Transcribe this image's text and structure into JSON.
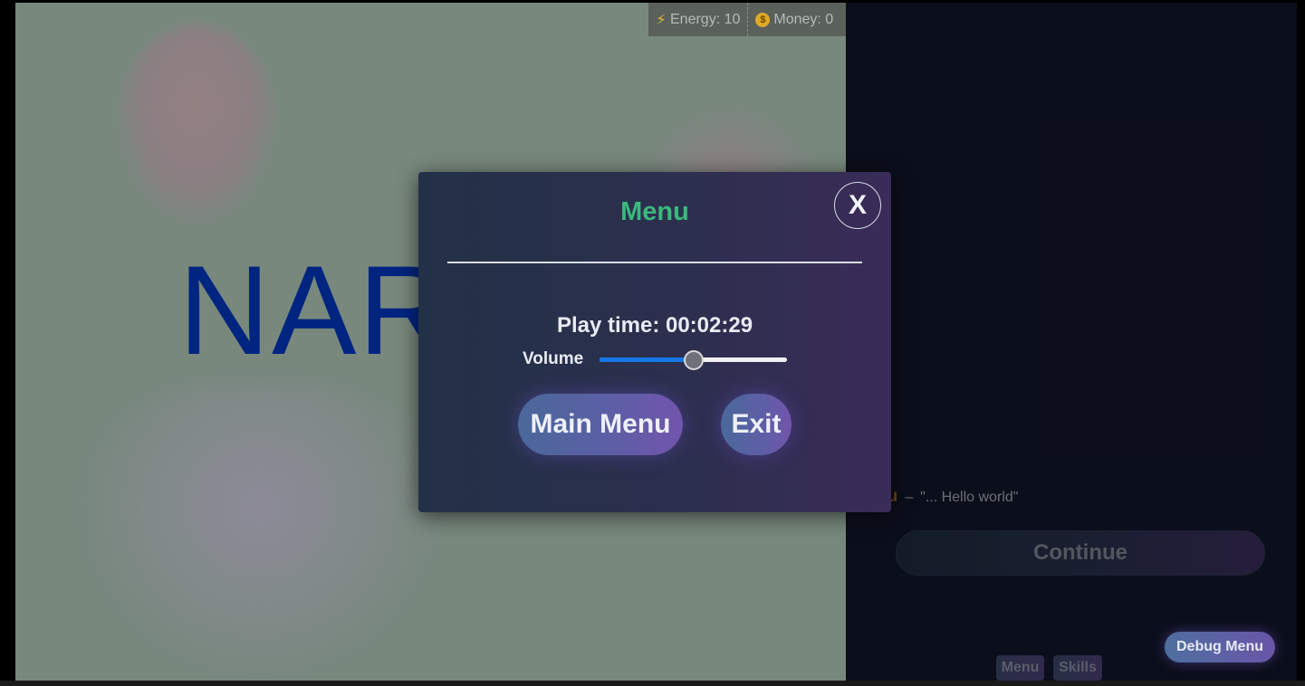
{
  "hud": {
    "energy_label": "Energy: 10",
    "money_label": "Money: 0",
    "energy_icon": "lightning-bolt-icon",
    "money_icon": "coin-icon"
  },
  "scene": {
    "backdrop_text": "NAR"
  },
  "dialog": {
    "speaker": "ou",
    "separator": "–",
    "line": "\"... Hello world\"",
    "continue_label": "Continue"
  },
  "bottom_bar": {
    "menu_label": "Menu",
    "skills_label": "Skills",
    "debug_label": "Debug Menu"
  },
  "modal": {
    "title": "Menu",
    "close_label": "X",
    "playtime": "Play time: 00:02:29",
    "volume_label": "Volume",
    "volume_value": 0.5,
    "main_menu_label": "Main Menu",
    "exit_label": "Exit"
  },
  "colors": {
    "title_green": "#3ab97c",
    "accent_blue": "#1677e8",
    "speaker_orange": "#b8660f"
  }
}
